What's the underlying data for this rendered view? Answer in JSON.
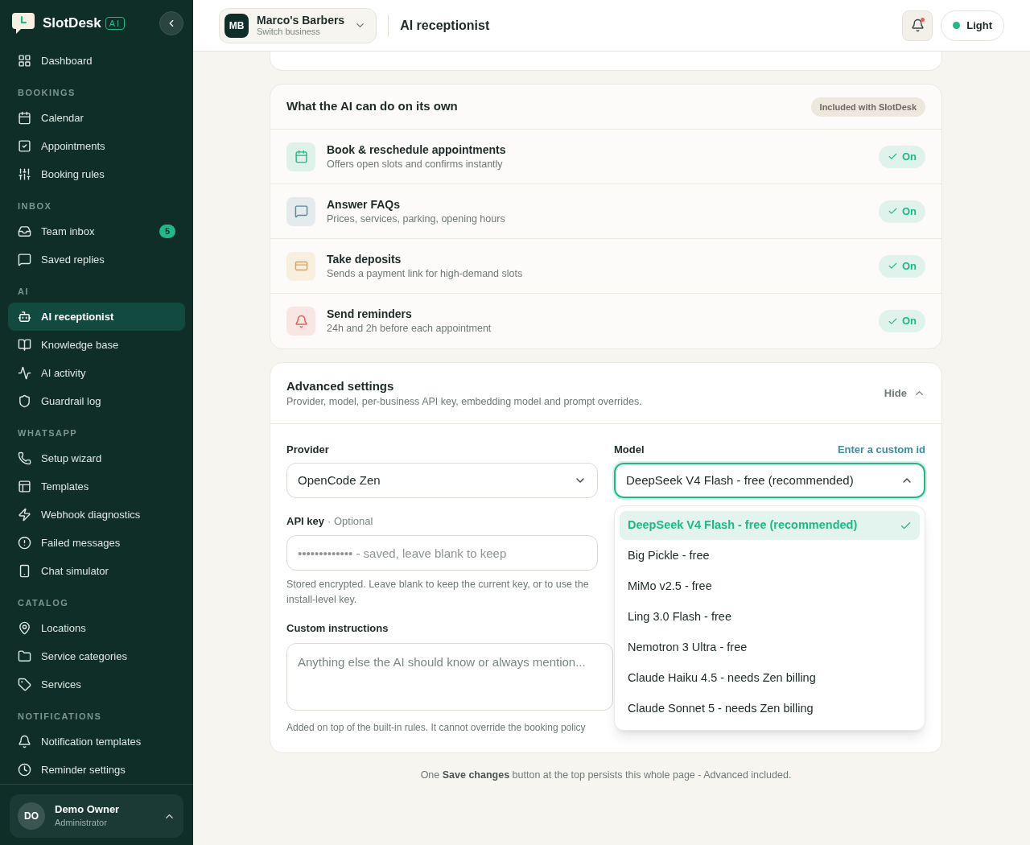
{
  "sidebar": {
    "brand": "SlotDesk",
    "brand_tag": "AI",
    "top_items": [
      {
        "label": "Dashboard",
        "selected": false
      }
    ],
    "sections": [
      {
        "title": "BOOKINGS",
        "items": [
          {
            "label": "Calendar",
            "selected": false
          },
          {
            "label": "Appointments",
            "selected": false
          },
          {
            "label": "Booking rules",
            "selected": false
          }
        ]
      },
      {
        "title": "INBOX",
        "items": [
          {
            "label": "Team inbox",
            "selected": false,
            "badge": "5"
          },
          {
            "label": "Saved replies",
            "selected": false
          }
        ]
      },
      {
        "title": "AI",
        "items": [
          {
            "label": "AI receptionist",
            "selected": true
          },
          {
            "label": "Knowledge base",
            "selected": false
          },
          {
            "label": "AI activity",
            "selected": false
          },
          {
            "label": "Guardrail log",
            "selected": false
          }
        ]
      },
      {
        "title": "WHATSAPP",
        "items": [
          {
            "label": "Setup wizard",
            "selected": false
          },
          {
            "label": "Templates",
            "selected": false
          },
          {
            "label": "Webhook diagnostics",
            "selected": false
          },
          {
            "label": "Failed messages",
            "selected": false
          },
          {
            "label": "Chat simulator",
            "selected": false
          }
        ]
      },
      {
        "title": "CATALOG",
        "items": [
          {
            "label": "Locations",
            "selected": false
          },
          {
            "label": "Service categories",
            "selected": false
          },
          {
            "label": "Services",
            "selected": false
          }
        ]
      },
      {
        "title": "NOTIFICATIONS",
        "items": [
          {
            "label": "Notification templates",
            "selected": false
          },
          {
            "label": "Reminder settings",
            "selected": false
          }
        ]
      }
    ],
    "user": {
      "initials": "DO",
      "name": "Demo Owner",
      "role": "Administrator"
    }
  },
  "header": {
    "business": {
      "initials": "MB",
      "name": "Marco's Barbers",
      "hint": "Switch business"
    },
    "title": "AI receptionist",
    "notifications_unread": true,
    "theme": "Light"
  },
  "capabilities": {
    "title": "What the AI can do on its own",
    "badge": "Included with SlotDesk",
    "items": [
      {
        "title": "Book & reschedule appointments",
        "description": "Offers open slots and confirms instantly",
        "color": "#1fb889",
        "on": true,
        "status": "On"
      },
      {
        "title": "Answer FAQs",
        "description": "Prices, services, parking, opening hours",
        "color": "#4f8aa0",
        "on": true,
        "status": "On"
      },
      {
        "title": "Take deposits",
        "description": "Sends a payment link for high-demand slots",
        "color": "#e3a43a",
        "on": true,
        "status": "On"
      },
      {
        "title": "Send reminders",
        "description": "24h and 2h before each appointment",
        "color": "#e0605a",
        "on": true,
        "status": "On"
      }
    ]
  },
  "advanced": {
    "title": "Advanced settings",
    "description": "Provider, model, per-business API key, embedding model and prompt overrides.",
    "toggle": "Hide",
    "expanded": true,
    "provider": {
      "label": "Provider",
      "value": "OpenCode Zen"
    },
    "model": {
      "label": "Model",
      "link": "Enter a custom id",
      "value": "DeepSeek V4 Flash - free (recommended)",
      "open": true,
      "options": [
        {
          "label": "DeepSeek V4 Flash - free (recommended)",
          "selected": true
        },
        {
          "label": "Big Pickle - free",
          "selected": false
        },
        {
          "label": "MiMo v2.5 - free",
          "selected": false
        },
        {
          "label": "Ling 3.0 Flash - free",
          "selected": false
        },
        {
          "label": "Nemotron 3 Ultra - free",
          "selected": false
        },
        {
          "label": "Claude Haiku 4.5 - needs Zen billing",
          "selected": false
        },
        {
          "label": "Claude Sonnet 5 - needs Zen billing",
          "selected": false
        }
      ]
    },
    "api_key": {
      "label": "API key",
      "optional": "· Optional",
      "placeholder": "••••••••••••• - saved, leave blank to keep",
      "help": "Stored encrypted. Leave blank to keep the current key, or to use the install-level key."
    },
    "instructions": {
      "label": "Custom instructions",
      "placeholder": "Anything else the AI should know or always mention...",
      "help": "Added on top of the built-in rules. It cannot override the booking policy"
    }
  },
  "footer_note": "One **Save changes** button at the top persists this whole page - Advanced included."
}
